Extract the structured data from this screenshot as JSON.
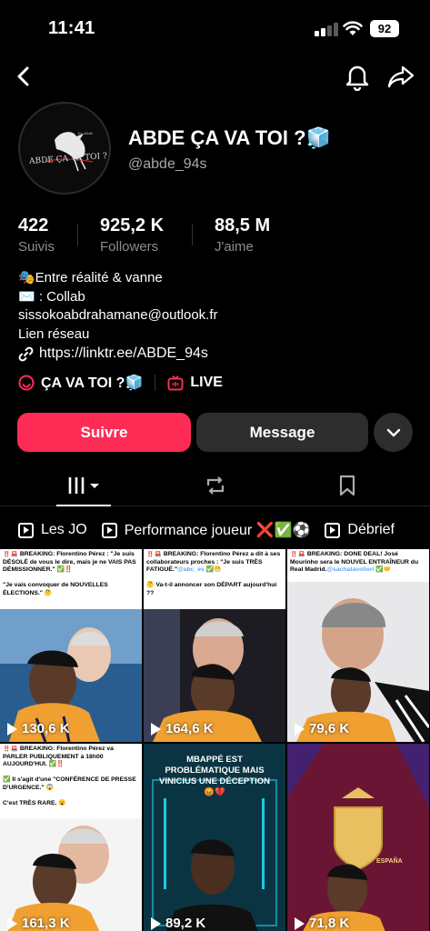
{
  "status": {
    "time": "11:41",
    "battery": "92"
  },
  "profile": {
    "display_name": "ABDE ÇA VA TOI ?🧊",
    "username": "@abde_94s",
    "avatar_text": "ABDE ÇA VA TOI ?"
  },
  "stats": [
    {
      "value": "422",
      "label": "Suivis"
    },
    {
      "value": "925,2 K",
      "label": "Followers"
    },
    {
      "value": "88,5 M",
      "label": "J'aime"
    }
  ],
  "bio": {
    "line1": "🎭Entre réalité & vanne",
    "line2": "✉️ : Collab",
    "line3": "sissokoabdrahamane@outlook.fr",
    "line4": "Lien réseau",
    "link": "https://linktr.ee/ABDE_94s"
  },
  "chips": {
    "group_label": "ÇA VA TOI ?🧊",
    "live_label": "LIVE"
  },
  "buttons": {
    "follow": "Suivre",
    "message": "Message"
  },
  "playlists": [
    {
      "label": "Les JO"
    },
    {
      "label": "Performance joueur ❌✅⚽"
    },
    {
      "label": "Débrief"
    }
  ],
  "videos": [
    {
      "caption_a": "‼️🚨 BREAKING: Florentino Pérez : \"Je suis DÉSOLÉ de vous le dire, mais je ne VAIS PAS DÉMISSIONNER.\" ✅‼️",
      "caption_b": "\"Je vais convoquer de NOUVELLES ÉLECTIONS.\" 🤔",
      "views": "130,6 K"
    },
    {
      "caption_a": "‼️🚨 BREAKING: Florentino Pérez a dit à ses collaborateurs proches : \"Je suis TRÈS FATIGUÉ.\"",
      "handle": "@abc_es",
      "caption_a_end": " ✅😁",
      "caption_b": "🤔 Va-t-il annoncer son DÉPART aujourd'hui ??",
      "views": "164,6 K"
    },
    {
      "caption_a": "‼️🚨 BREAKING: DONE DEAL! José Mourinho sera le NOUVEL ENTRAÎNEUR du Real Madrid.",
      "handle": "@sachatavolieri",
      "caption_a_end": " ✅🤝",
      "views": "79,6 K"
    },
    {
      "caption_a": "‼️🚨 BREAKING: Florentino Pérez va PARLER PUBLIQUEMENT à 18h00 AUJOURD'HUI. ✅‼️",
      "caption_b": "✅ Il s'agit d'une \"CONFÉRENCE DE PRESSE D'URGENCE.\" 😱",
      "caption_c": "C'est TRÈS RARE. 😮",
      "views": "161,3 K"
    },
    {
      "headline": "MBAPPÉ EST PROBLÉMATIQUE MAIS VINICIUS UNE DÉCEPTION 😡💔",
      "views": "89,2 K"
    },
    {
      "badge": "ESPAÑA",
      "views": "71,8 K"
    }
  ]
}
